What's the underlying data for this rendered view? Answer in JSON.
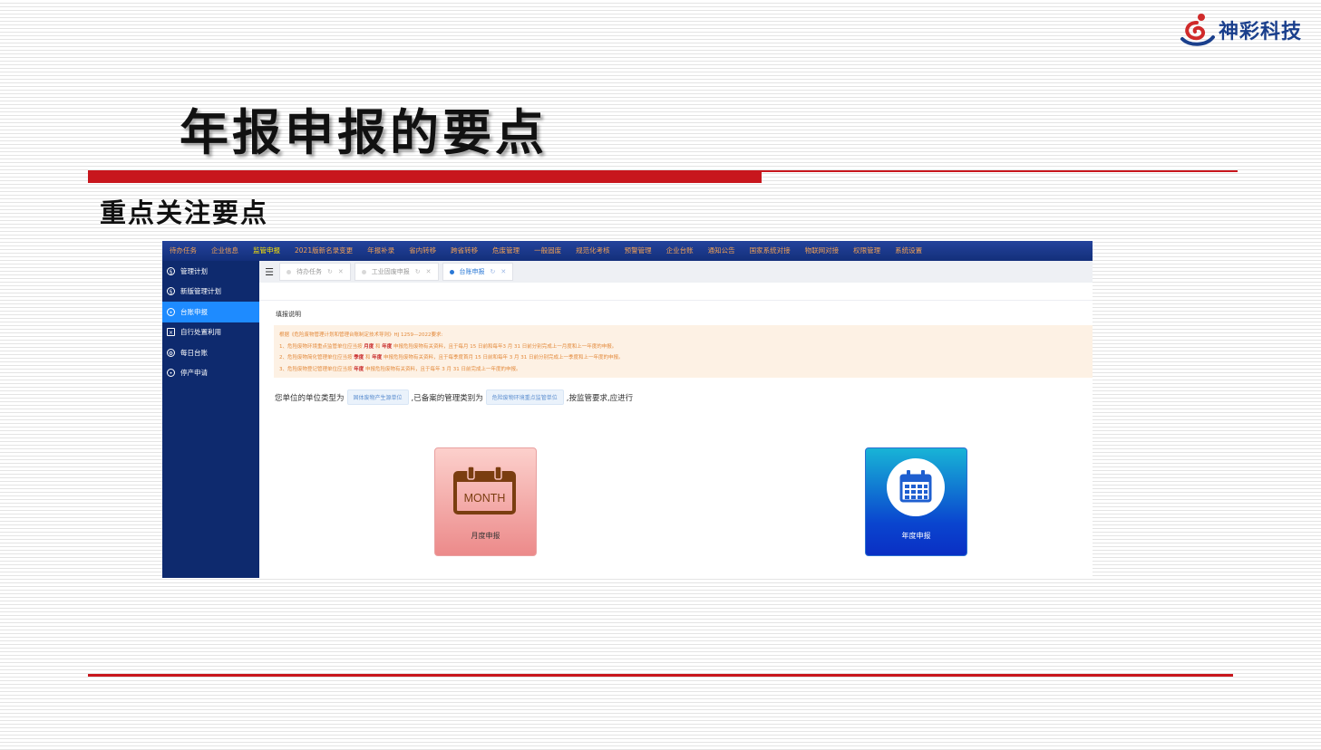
{
  "slide": {
    "brand": "神彩科技",
    "title": "年报申报的要点",
    "subtitle": "重点关注要点"
  },
  "app": {
    "topnav": [
      "待办任务",
      "企业信息",
      "监管申报",
      "2021版新名录变更",
      "年报补录",
      "省内转移",
      "跨省转移",
      "危废管理",
      "一般固废",
      "规范化考核",
      "预警管理",
      "企业台账",
      "通知公告",
      "国家系统对接",
      "物联网对接",
      "权限管理",
      "系统设置"
    ],
    "topnav_active_index": 2,
    "sidebar": [
      {
        "label": "管理计划",
        "icon": "plan-icon",
        "active": false
      },
      {
        "label": "新版管理计划",
        "icon": "plan-icon",
        "active": false
      },
      {
        "label": "台账申报",
        "icon": "target-icon",
        "active": true
      },
      {
        "label": "自行处置利用",
        "icon": "dispose-icon",
        "active": false
      },
      {
        "label": "每日台账",
        "icon": "gear-icon",
        "active": false
      },
      {
        "label": "停产申请",
        "icon": "stop-icon",
        "active": false
      }
    ],
    "tabs": [
      {
        "label": "待办任务",
        "active": false
      },
      {
        "label": "工业固废申报",
        "active": false
      },
      {
        "label": "台账申报",
        "active": true
      }
    ],
    "section_label": "填报说明",
    "notice": {
      "line0": "根据《危险废物管理计划和管理台账制定技术导则》HJ 1259—2022要求:",
      "line1_pre": "1、危险废物环境重点监管单位应当按 ",
      "line1_b1": "月度",
      "line1_mid": " 和 ",
      "line1_b2": "年度",
      "line1_post": " 申报危险废物有关资料，且于每月 15 日前和每年3 月 31 日前分别完成上一月度和上一年度的申报。",
      "line2_pre": "2、危险废物简化管理单位应当按 ",
      "line2_b1": "季度",
      "line2_mid": " 和 ",
      "line2_b2": "年度",
      "line2_post": " 申报危险废物有关资料，且于每季度首月 15 日前和每年 3 月 31 日前分别完成上一季度和上一年度的申报。",
      "line3_pre": "3、危险废物登记管理单位应当按 ",
      "line3_b1": "年度",
      "line3_post": " 申报危险废物有关资料，且于每年 3 月 31 日前完成上一年度的申报。"
    },
    "unit": {
      "prefix": "您单位的单位类型为",
      "type": "固体废物产生源单位",
      "middle": ",已备案的管理类别为",
      "category": "危险废物环境重点监管单位",
      "suffix": ",按监管要求,应进行"
    },
    "cards": {
      "month_icon_text": "MONTH",
      "month_label": "月度申报",
      "year_label": "年度申报"
    }
  }
}
